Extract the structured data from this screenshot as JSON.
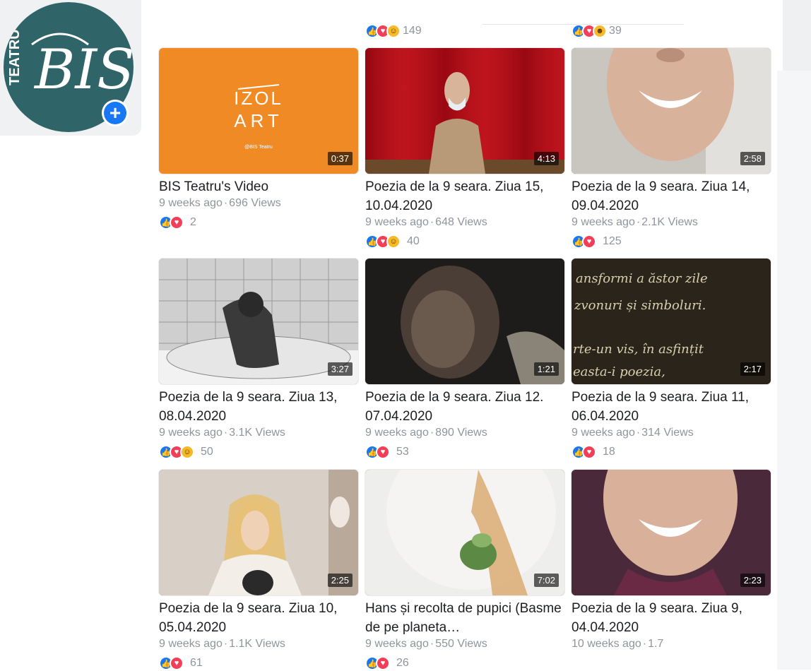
{
  "profile": {
    "logo_small": "TEATRU",
    "logo_big": "BIS",
    "add_icon": "plus-icon"
  },
  "top_row": {
    "left_count": "149",
    "right_count": "39"
  },
  "cards": [
    {
      "title": "BIS Teatru's Video",
      "time": "9 weeks ago",
      "views": "696 Views",
      "count": "2",
      "duration": "0:37",
      "reactions": [
        "like",
        "love"
      ],
      "thumb_text_1": "IZOL",
      "thumb_text_2": "ART",
      "thumb_caption": "@BIS Teatru"
    },
    {
      "title": "Poezia de la 9 seara. Ziua 15, 10.04.2020",
      "time": "9 weeks ago",
      "views": "648 Views",
      "count": "40",
      "duration": "4:13",
      "reactions": [
        "like",
        "love",
        "wow"
      ]
    },
    {
      "title": "Poezia de la 9 seara. Ziua 14, 09.04.2020",
      "time": "9 weeks ago",
      "views": "2.1K Views",
      "count": "125",
      "duration": "2:58",
      "reactions": [
        "like",
        "love"
      ]
    },
    {
      "title": "Poezia de la 9 seara. Ziua 13, 08.04.2020",
      "time": "9 weeks ago",
      "views": "3.1K Views",
      "count": "50",
      "duration": "3:27",
      "reactions": [
        "like",
        "love",
        "wow"
      ]
    },
    {
      "title": "Poezia de la 9 seara. Ziua 12. 07.04.2020",
      "time": "9 weeks ago",
      "views": "890 Views",
      "count": "53",
      "duration": "1:21",
      "reactions": [
        "like",
        "love"
      ]
    },
    {
      "title": "Poezia de la 9 seara. Ziua 11, 06.04.2020",
      "time": "9 weeks ago",
      "views": "314 Views",
      "count": "18",
      "duration": "2:17",
      "reactions": [
        "like",
        "love"
      ],
      "thumb_lines": [
        "ansformi a ăstor zile",
        "zvonuri și simboluri.",
        "rte-un vis, în asfințit",
        "easta-i poezia,"
      ]
    },
    {
      "title": "Poezia de la 9 seara. Ziua 10, 05.04.2020",
      "time": "9 weeks ago",
      "views": "1.1K Views",
      "count": "61",
      "duration": "2:25",
      "reactions": [
        "like",
        "love"
      ]
    },
    {
      "title": "Hans și recolta de pupici (Basme de pe planeta…",
      "time": "9 weeks ago",
      "views": "550 Views",
      "count": "26",
      "duration": "7:02",
      "reactions": [
        "like",
        "love"
      ]
    },
    {
      "title": "Poezia de la 9 seara. Ziua 9, 04.04.2020",
      "time": "10 weeks ago",
      "views": "1.7",
      "count": "",
      "duration": "2:23",
      "reactions": []
    }
  ],
  "colors": {
    "like": "#1877f2",
    "love": "#f33e58",
    "wow": "#f7b928",
    "avatar_bg": "#2f6468",
    "izol_bg": "#f08a24"
  }
}
